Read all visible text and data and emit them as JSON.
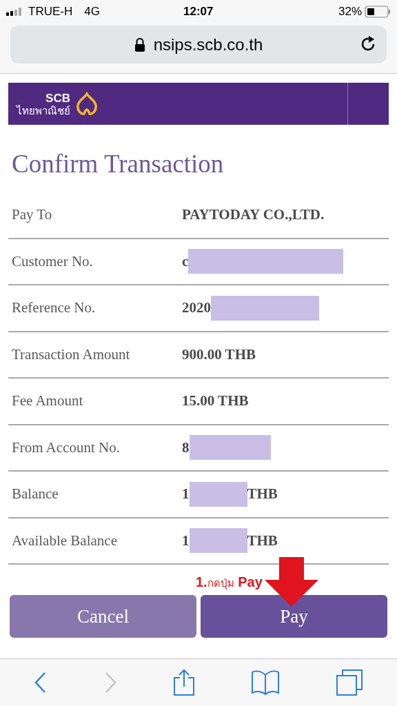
{
  "status_bar": {
    "carrier": "TRUE-H",
    "network": "4G",
    "time": "12:07",
    "battery": "32%"
  },
  "address_bar": {
    "url": "nsips.scb.co.th"
  },
  "banner": {
    "logo_text": "SCB",
    "logo_subtext": "ไทยพาณิชย์"
  },
  "title": "Confirm Transaction",
  "rows": [
    {
      "label": "Pay To",
      "value": "PAYTODAY CO.,LTD."
    },
    {
      "label": "Customer No.",
      "value": "c",
      "redacted": true
    },
    {
      "label": "Reference No.",
      "value": "2020",
      "redacted": true
    },
    {
      "label": "Transaction Amount",
      "value": "900.00 THB"
    },
    {
      "label": "Fee Amount",
      "value": "15.00 THB"
    },
    {
      "label": "From Account No.",
      "value": "8",
      "redacted": true
    },
    {
      "label": "Balance",
      "value": "1",
      "redacted": true,
      "suffix": "THB"
    },
    {
      "label": "Available Balance",
      "value": "1",
      "redacted": true,
      "suffix": "THB"
    }
  ],
  "annotation": {
    "number": "1.",
    "text": "กดปุ่ม",
    "target": "Pay"
  },
  "buttons": [
    {
      "label": "Cancel",
      "kind": "secondary"
    },
    {
      "label": "Pay",
      "kind": "primary"
    }
  ]
}
